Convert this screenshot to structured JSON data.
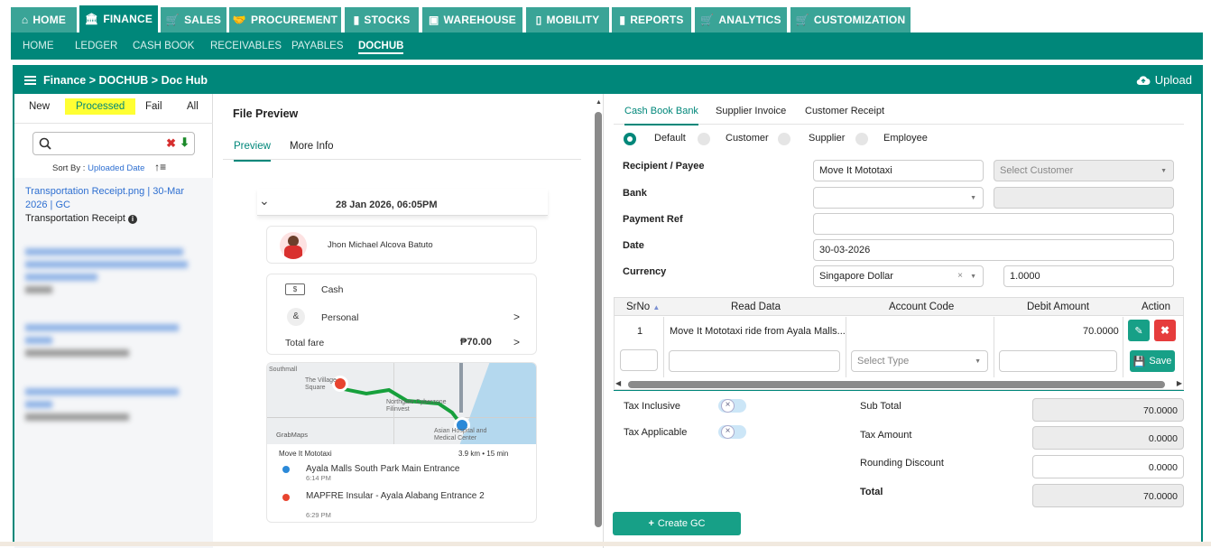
{
  "top_nav": [
    {
      "label": "HOME",
      "icon": "home-icon"
    },
    {
      "label": "FINANCE",
      "icon": "bank-icon",
      "active": true
    },
    {
      "label": "SALES",
      "icon": "cart-icon"
    },
    {
      "label": "PROCUREMENT",
      "icon": "handshake-icon"
    },
    {
      "label": "STOCKS",
      "icon": "bar-chart-icon"
    },
    {
      "label": "WAREHOUSE",
      "icon": "box-icon"
    },
    {
      "label": "MOBILITY",
      "icon": "mobile-icon"
    },
    {
      "label": "REPORTS",
      "icon": "bar-chart-icon"
    },
    {
      "label": "ANALYTICS",
      "icon": "cart-icon"
    },
    {
      "label": "CUSTOMIZATION",
      "icon": "cart-icon"
    }
  ],
  "sub_nav": [
    "HOME",
    "LEDGER",
    "CASH BOOK",
    "RECEIVABLES",
    "PAYABLES",
    "DOCHUB"
  ],
  "sub_nav_active": "DOCHUB",
  "header": {
    "breadcrumb": "Finance > DOCHUB > Doc Hub",
    "upload_label": "Upload"
  },
  "filters": {
    "tabs": [
      "New",
      "Processed",
      "Fail",
      "All"
    ],
    "active": "Processed"
  },
  "sort": {
    "prefix": "Sort By :",
    "field": "Uploaded Date"
  },
  "documents": [
    {
      "title": "Transportation Receipt.png | 30-Mar 2026 | GC",
      "type": "Transportation Receipt"
    }
  ],
  "preview": {
    "title": "File Preview",
    "tabs": [
      "Preview",
      "More Info"
    ],
    "receipt": {
      "datetime": "28 Jan 2026, 06:05PM",
      "driver": "Jhon Michael Alcova Batuto",
      "payment": "Cash",
      "profile": "Personal",
      "total_label": "Total fare",
      "total": "₱70.00",
      "map_labels": [
        "Southmall",
        "The Village Square",
        "Northgate Cyberzone Filinvest",
        "Asian Hospital and Medical Center",
        "GrabMaps"
      ],
      "service": "Move It Mototaxi",
      "distance": "3.9 km • 15 min",
      "pickup": "Ayala Malls South Park Main Entrance",
      "pickup_time": "6:14 PM",
      "dropoff": "MAPFRE Insular - Ayala Alabang Entrance 2",
      "dropoff_time": "6:29 PM"
    }
  },
  "form": {
    "tabs": [
      "Cash Book Bank",
      "Supplier Invoice",
      "Customer Receipt"
    ],
    "active_tab": "Cash Book Bank",
    "radios": [
      "Default",
      "Customer",
      "Supplier",
      "Employee"
    ],
    "radio_selected": "Default",
    "recipient_label": "Recipient / Payee",
    "recipient_value": "Move It Mototaxi",
    "customer_placeholder": "Select Customer",
    "bank_label": "Bank",
    "payment_ref_label": "Payment Ref",
    "date_label": "Date",
    "date_value": "30-03-2026",
    "currency_label": "Currency",
    "currency_value": "Singapore Dollar",
    "rate_value": "1.0000"
  },
  "table": {
    "headers": [
      "SrNo",
      "Read Data",
      "Account Code",
      "Debit Amount",
      "Action"
    ],
    "rows": [
      {
        "srno": "1",
        "read_data": "Move It Mototaxi ride from Ayala Malls...",
        "account_code": "",
        "debit": "70.0000"
      }
    ],
    "new_row_type_placeholder": "Select Type",
    "save_label": "Save"
  },
  "totals": {
    "tax_inclusive_label": "Tax Inclusive",
    "tax_applicable_label": "Tax Applicable",
    "sub_total_label": "Sub Total",
    "sub_total": "70.0000",
    "tax_amount_label": "Tax Amount",
    "tax_amount": "0.0000",
    "rounding_label": "Rounding Discount",
    "rounding": "0.0000",
    "total_label": "Total",
    "total": "70.0000"
  },
  "create_gc_label": "Create GC",
  "colors": {
    "primary": "#00877a",
    "tab": "#3aa497",
    "link": "#2e6fd1",
    "danger": "#e63c3c",
    "highlight": "#ffff33"
  }
}
